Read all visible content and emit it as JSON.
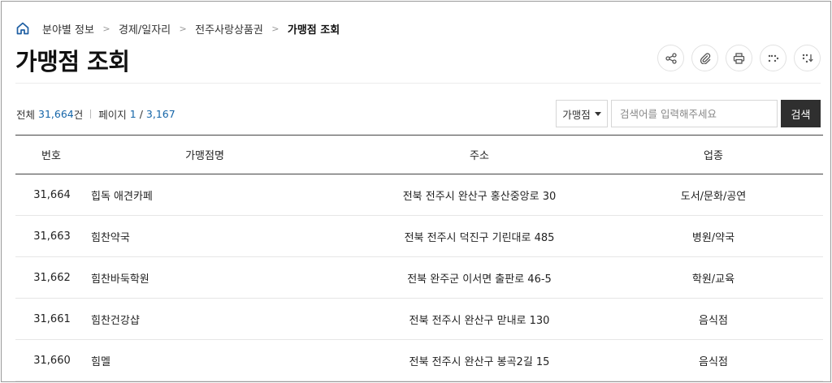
{
  "breadcrumb": {
    "items": [
      "분야별 정보",
      "경제/일자리",
      "전주사랑상품권"
    ],
    "current": "가맹점 조회",
    "separator": ">"
  },
  "page": {
    "title": "가맹점 조회"
  },
  "tools": {
    "icons": [
      "share-icon",
      "attachment-icon",
      "print-icon",
      "braille-icon",
      "braille-download-icon"
    ]
  },
  "summary": {
    "total_label": "전체",
    "total_count": "31,664",
    "total_unit": "건",
    "page_label": "페이지",
    "current_page": "1",
    "page_sep": " / ",
    "total_pages": "3,167"
  },
  "search": {
    "select_value": "가맹점",
    "placeholder": "검색어를 입력해주세요",
    "button_label": "검색"
  },
  "table": {
    "headers": {
      "no": "번호",
      "name": "가맹점명",
      "address": "주소",
      "category": "업종"
    },
    "rows": [
      {
        "no": "31,664",
        "name": "힙독 애견카페",
        "address": "전북 전주시 완산구 홍산중앙로 30",
        "category": "도서/문화/공연"
      },
      {
        "no": "31,663",
        "name": "힘찬약국",
        "address": "전북 전주시 덕진구 기린대로 485",
        "category": "병원/약국"
      },
      {
        "no": "31,662",
        "name": "힘찬바둑학원",
        "address": "전북 완주군 이서면 출판로 46-5",
        "category": "학원/교육"
      },
      {
        "no": "31,661",
        "name": "힘찬건강샵",
        "address": "전북 전주시 완산구 맏내로 130",
        "category": "음식점"
      },
      {
        "no": "31,660",
        "name": "힘멜",
        "address": "전북 전주시 완산구 봉곡2길 15",
        "category": "음식점"
      }
    ]
  },
  "colors": {
    "accent": "#1565a8",
    "button_bg": "#2f2f2f",
    "home_icon": "#1f5fa3"
  }
}
